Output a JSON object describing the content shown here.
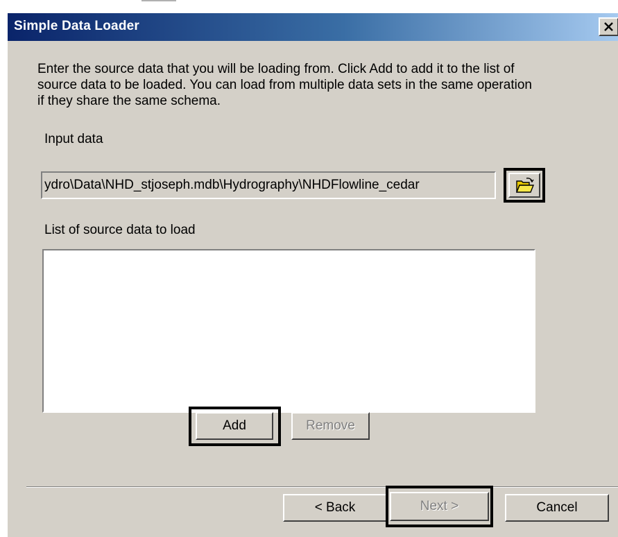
{
  "dialog": {
    "title": "Simple Data Loader",
    "close_label": "close",
    "instructions": "Enter the source data that you will be loading from. Click Add to add it to the list of source data to be loaded. You can load from multiple data sets in the same operation if they share the same schema.",
    "input_label": "Input data",
    "input_value": "ydro\\Data\\NHD_stjoseph.mdb\\Hydrography\\NHDFlowline_cedar",
    "list_label": "List of source data to load",
    "list_items": [],
    "add_label": "Add",
    "remove_label": "Remove",
    "back_label": "< Back",
    "next_label": "Next >",
    "cancel_label": "Cancel"
  },
  "icons": {
    "browse": "open-folder-icon",
    "close": "close-icon"
  },
  "colors": {
    "title_start": "#0a246a",
    "title_end": "#a6caf0",
    "face": "#d4d0c8",
    "disabled_text": "#808080"
  }
}
